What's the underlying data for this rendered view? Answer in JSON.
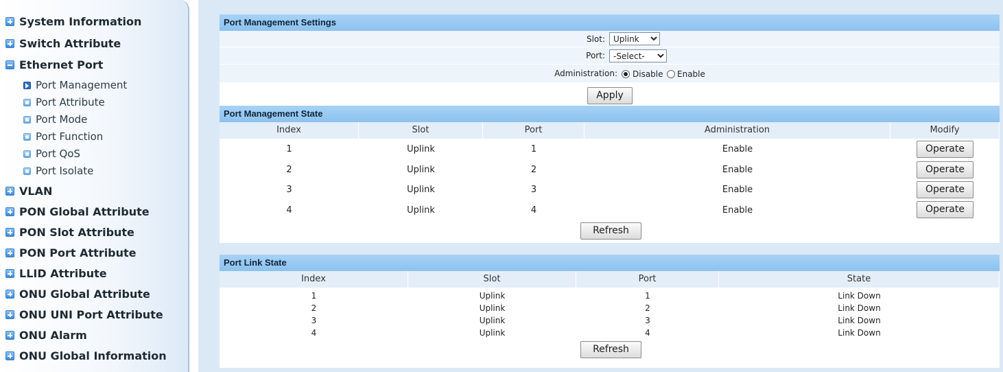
{
  "sidebar": {
    "items": [
      {
        "label": "System Information",
        "state": "collapsed"
      },
      {
        "label": "Switch Attribute",
        "state": "collapsed"
      },
      {
        "label": "Ethernet Port",
        "state": "expanded"
      },
      {
        "label": "VLAN",
        "state": "collapsed"
      },
      {
        "label": "PON Global Attribute",
        "state": "collapsed"
      },
      {
        "label": "PON Slot Attribute",
        "state": "collapsed"
      },
      {
        "label": "PON Port Attribute",
        "state": "collapsed"
      },
      {
        "label": "LLID Attribute",
        "state": "collapsed"
      },
      {
        "label": "ONU Global Attribute",
        "state": "collapsed"
      },
      {
        "label": "ONU UNI Port Attribute",
        "state": "collapsed"
      },
      {
        "label": "ONU Alarm",
        "state": "collapsed"
      },
      {
        "label": "ONU Global Information",
        "state": "collapsed"
      }
    ],
    "subitems": [
      {
        "label": "Port Management",
        "active": true
      },
      {
        "label": "Port Attribute",
        "active": false
      },
      {
        "label": "Port Mode",
        "active": false
      },
      {
        "label": "Port Function",
        "active": false
      },
      {
        "label": "Port QoS",
        "active": false
      },
      {
        "label": "Port Isolate",
        "active": false
      }
    ]
  },
  "settings": {
    "title": "Port Management Settings",
    "slot_label": "Slot:",
    "slot_value": "Uplink",
    "port_label": "Port:",
    "port_value": "-Select-",
    "admin_label": "Administration:",
    "admin_options": [
      "Disable",
      "Enable"
    ],
    "admin_selected": "Disable",
    "apply_label": "Apply"
  },
  "state": {
    "title": "Port Management State",
    "headers": [
      "Index",
      "Slot",
      "Port",
      "Administration",
      "Modify"
    ],
    "rows": [
      {
        "index": "1",
        "slot": "Uplink",
        "port": "1",
        "admin": "Enable",
        "action": "Operate"
      },
      {
        "index": "2",
        "slot": "Uplink",
        "port": "2",
        "admin": "Enable",
        "action": "Operate"
      },
      {
        "index": "3",
        "slot": "Uplink",
        "port": "3",
        "admin": "Enable",
        "action": "Operate"
      },
      {
        "index": "4",
        "slot": "Uplink",
        "port": "4",
        "admin": "Enable",
        "action": "Operate"
      }
    ],
    "refresh_label": "Refresh"
  },
  "link": {
    "title": "Port Link State",
    "headers": [
      "Index",
      "Slot",
      "Port",
      "State"
    ],
    "rows": [
      {
        "index": "1",
        "slot": "Uplink",
        "port": "1",
        "state": "Link Down"
      },
      {
        "index": "2",
        "slot": "Uplink",
        "port": "2",
        "state": "Link Down"
      },
      {
        "index": "3",
        "slot": "Uplink",
        "port": "3",
        "state": "Link Down"
      },
      {
        "index": "4",
        "slot": "Uplink",
        "port": "4",
        "state": "Link Down"
      }
    ],
    "refresh_label": "Refresh"
  },
  "colors": {
    "header_bg": "#8cc2ee",
    "row_bg": "#eef4fb",
    "main_bg": "#dbe8f6",
    "icon_blue": "#3b8ad8"
  },
  "icons": {
    "collapsed": "plus-box-icon",
    "expanded": "minus-box-icon",
    "sub": "page-icon",
    "active_sub": "arrow-right-icon"
  }
}
